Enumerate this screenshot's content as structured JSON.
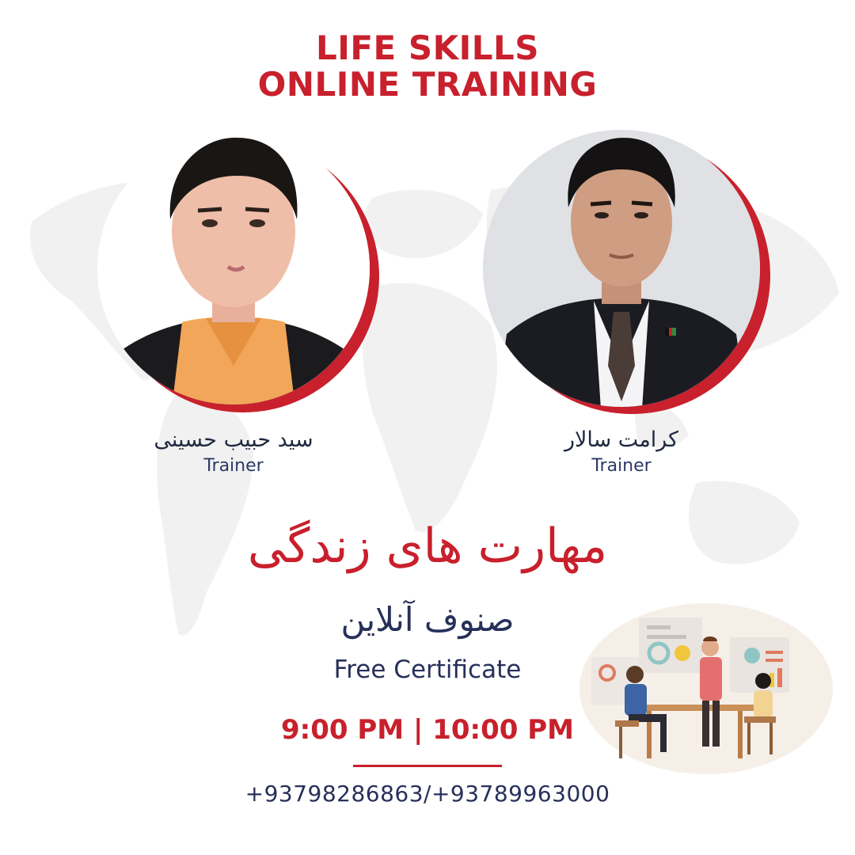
{
  "title": {
    "line1": "LIFE SKILLS",
    "line2": "ONLINE TRAINING"
  },
  "trainers": [
    {
      "name": "سید حبیب حسینی",
      "role": "Trainer"
    },
    {
      "name": "کرامت سالار",
      "role": "Trainer"
    }
  ],
  "course": {
    "title_fa": "مهارت های زندگی",
    "subtitle_fa": "صنوف آنلاین",
    "certificate": "Free Certificate",
    "time": "9:00 PM | 10:00 PM",
    "phone": "+93798286863/+93789963000"
  },
  "colors": {
    "accent": "#c8202c",
    "navy": "#27305a",
    "map": "#f1f1f1"
  },
  "icons": [
    "world-map",
    "team-meeting-illustration"
  ]
}
